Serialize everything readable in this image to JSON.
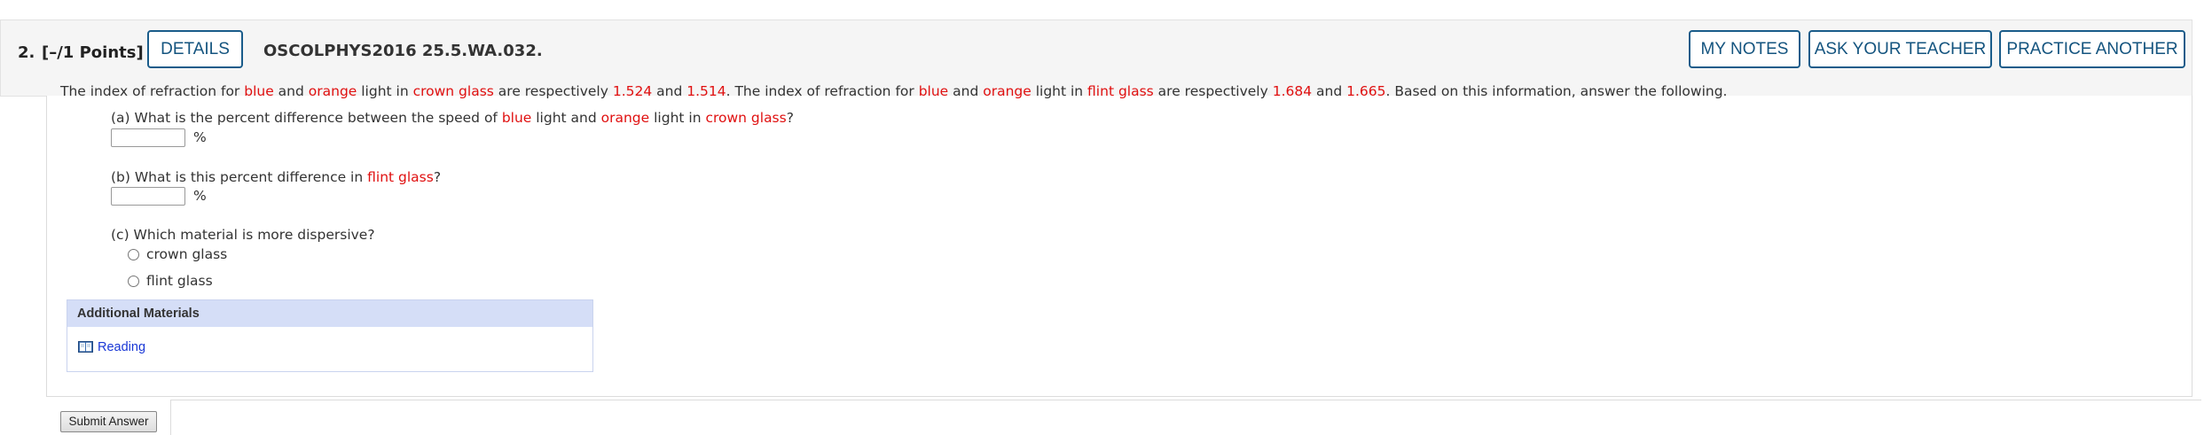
{
  "header": {
    "question_number": "2.",
    "points": "[–/1 Points]",
    "details_label": "DETAILS",
    "question_id": "OSCOLPHYS2016 25.5.WA.032.",
    "my_notes_label": "MY NOTES",
    "ask_teacher_label": "ASK YOUR TEACHER",
    "practice_label": "PRACTICE ANOTHER"
  },
  "intro": {
    "t1": "The index of refraction for ",
    "blue": "blue",
    "t2": " and ",
    "orange": "orange",
    "t3": " light in ",
    "crown": "crown glass",
    "t4": " are respectively ",
    "v1": "1.524",
    "t5": " and ",
    "v2": "1.514",
    "t6": ". The index of refraction for ",
    "blue2": "blue",
    "t7": " and ",
    "orange2": "orange",
    "t8": " light in ",
    "flint": "flint glass",
    "t9": " are respectively ",
    "v3": "1.684",
    "t10": " and ",
    "v4": "1.665",
    "t11": ". Based on this information, answer the following."
  },
  "part_a": {
    "t1": "(a) What is the percent difference between the speed of ",
    "blue": "blue",
    "t2": " light and ",
    "orange": "orange",
    "t3": " light in ",
    "crown": "crown glass",
    "t4": "?",
    "value": "",
    "unit": "%"
  },
  "part_b": {
    "t1": "(b) What is this percent difference in ",
    "flint": "flint glass",
    "t2": "?",
    "value": "",
    "unit": "%"
  },
  "part_c": {
    "prompt": "(c) Which material is more dispersive?",
    "options": [
      "crown glass",
      "flint glass"
    ]
  },
  "additional_materials": {
    "title": "Additional Materials",
    "reading_label": "Reading"
  },
  "submit_label": "Submit Answer",
  "colors": {
    "accent": "#14547f",
    "highlight_red": "#e01010",
    "link_blue": "#1a38d6",
    "addl_header": "#d5def7"
  }
}
